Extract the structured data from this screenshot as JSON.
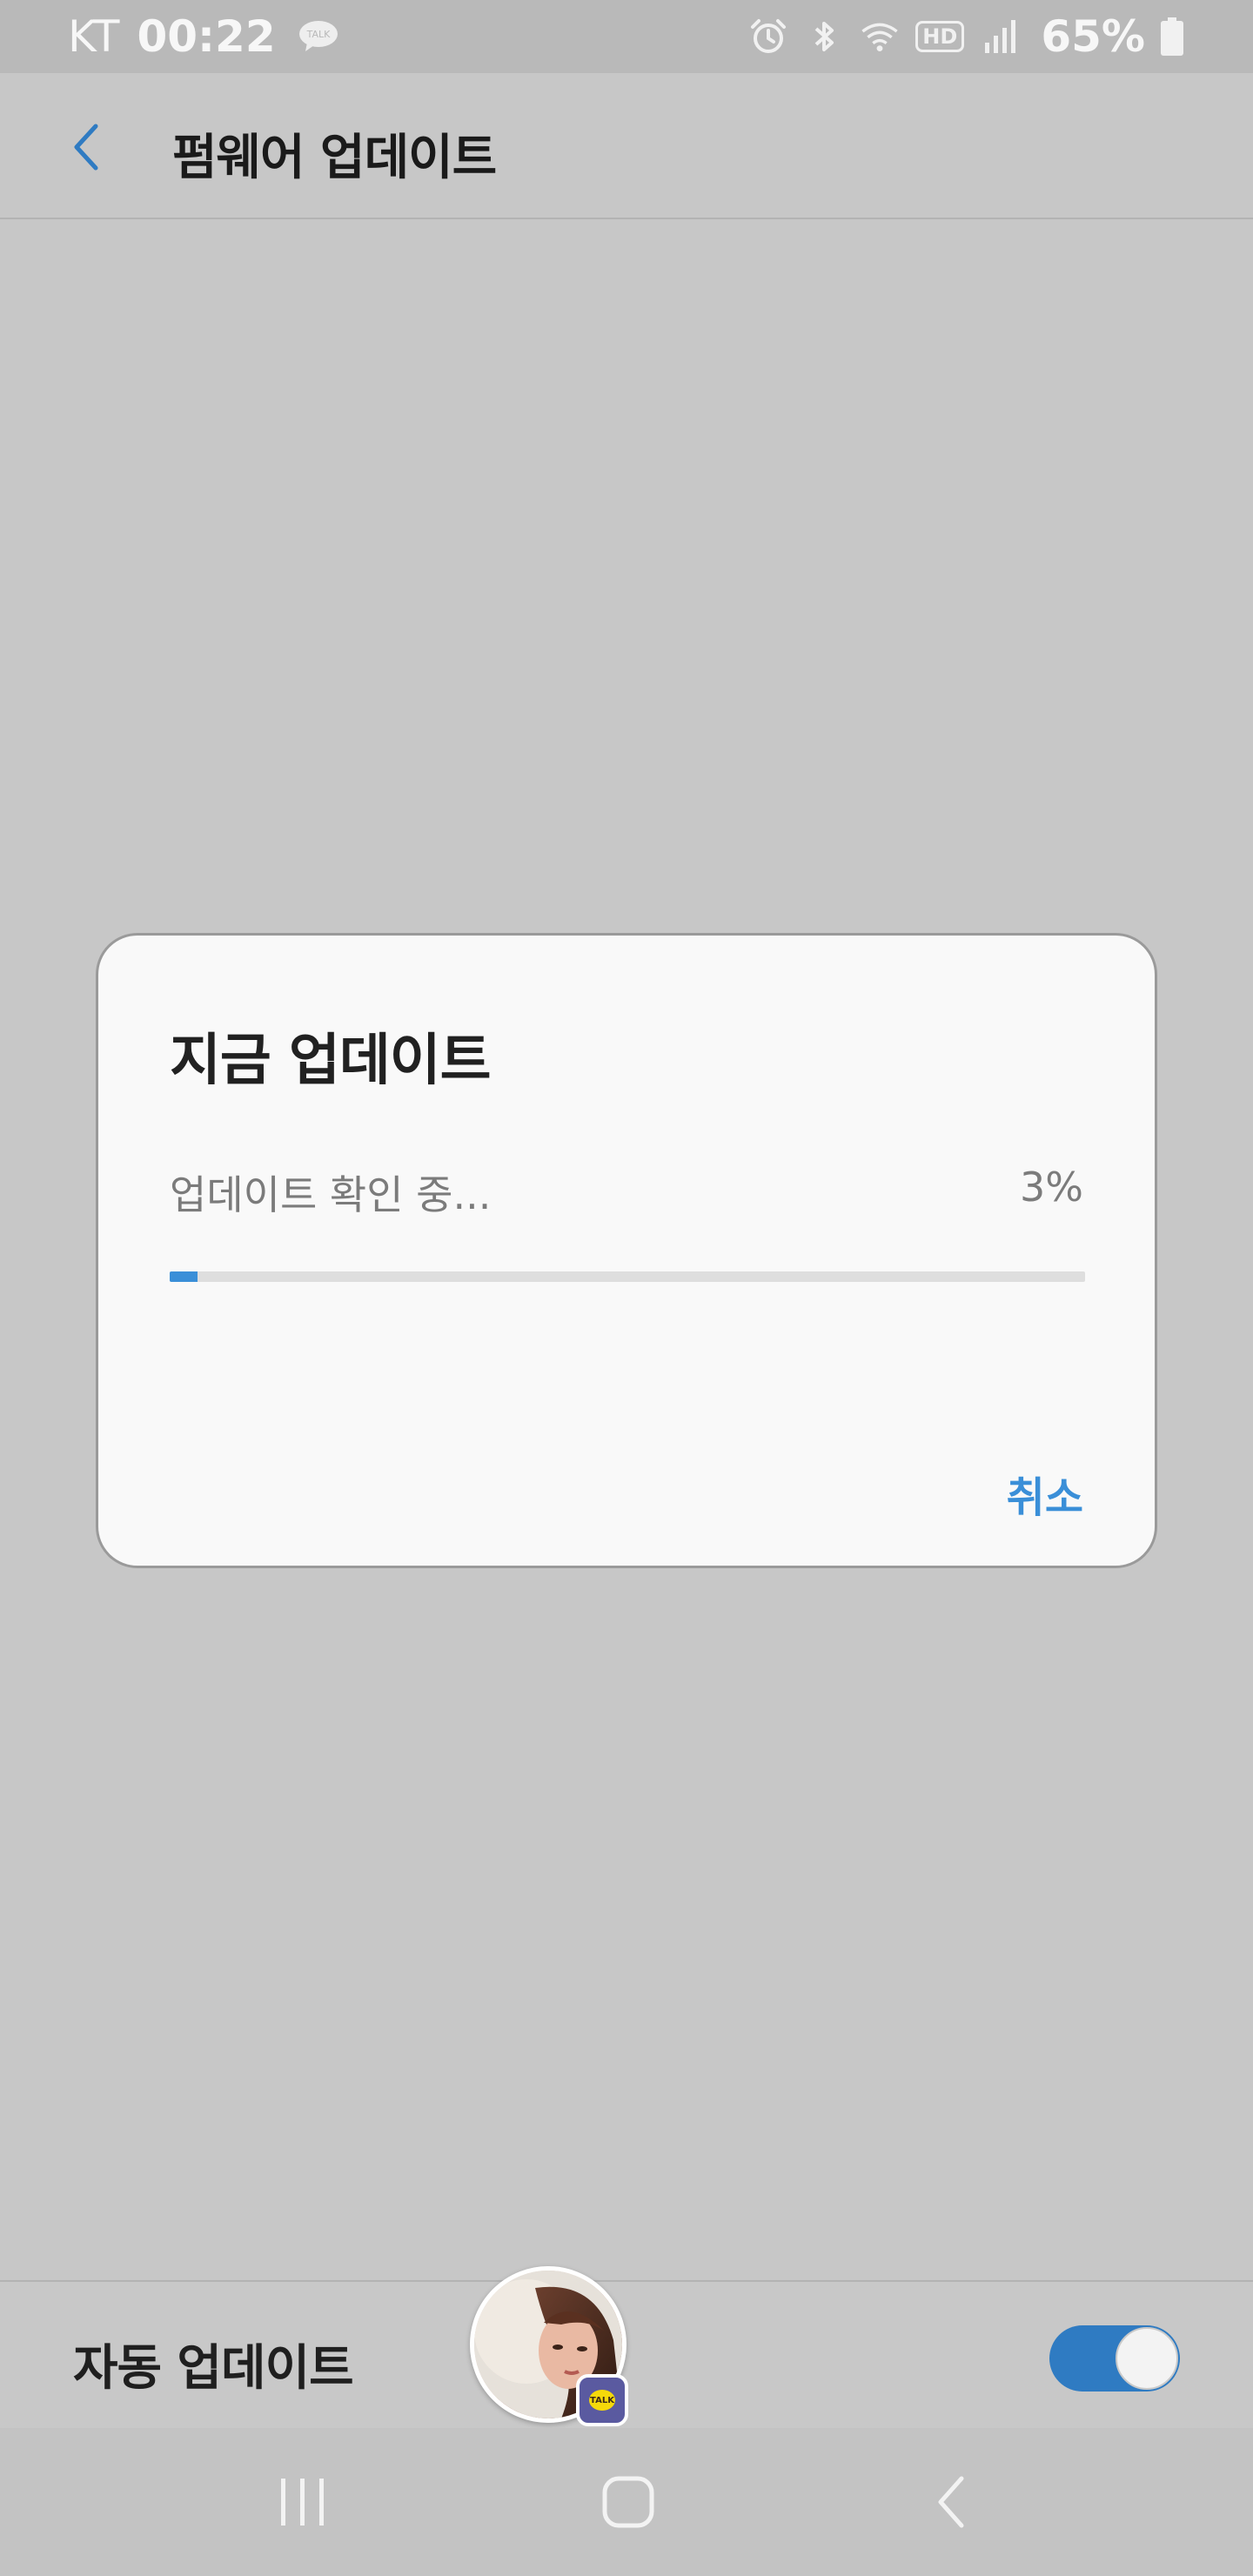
{
  "status_bar": {
    "carrier": "KT",
    "time": "00:22",
    "talk_icon_text": "TALK",
    "hd_label": "HD",
    "battery": "65%"
  },
  "header": {
    "title": "펌웨어 업데이트"
  },
  "dialog": {
    "title": "지금 업데이트",
    "progress_label": "업데이트 확인 중...",
    "progress_percent_text": "3%",
    "progress_value": 3,
    "cancel_label": "취소"
  },
  "auto_update": {
    "label": "자동 업데이트",
    "enabled": true
  },
  "colors": {
    "accent": "#3a8fd8",
    "toggle_on": "#2f7bc2",
    "overlay_background": "#c7c7c7"
  },
  "icons": {
    "back": "chevron-left-icon",
    "alarm": "alarm-icon",
    "bluetooth": "bluetooth-icon",
    "wifi": "wifi-icon",
    "signal": "signal-icon",
    "battery": "battery-icon",
    "nav_recents": "recents-icon",
    "nav_home": "home-icon",
    "nav_back": "back-icon"
  }
}
